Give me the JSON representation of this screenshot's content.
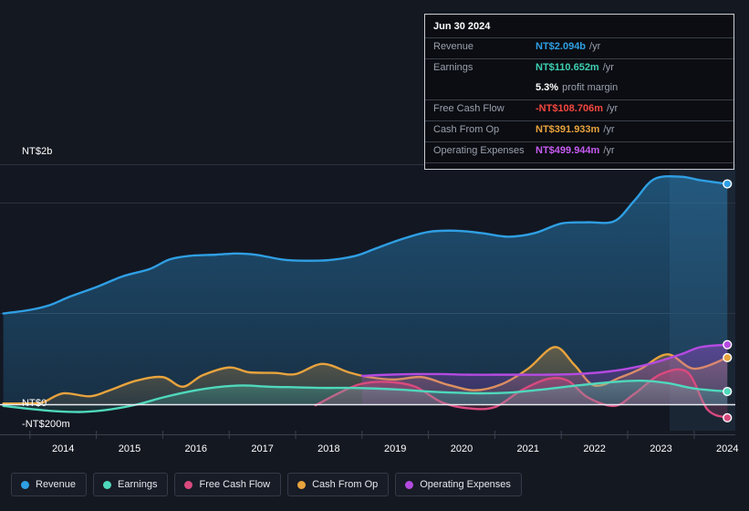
{
  "tooltip": {
    "date": "Jun 30 2024",
    "rows": [
      {
        "key": "Revenue",
        "value": "NT$2.094b",
        "suffix": "/yr",
        "color": "#2f9fe3"
      },
      {
        "key": "Earnings",
        "value": "NT$110.652m",
        "suffix": "/yr",
        "color": "#3ecfb2"
      },
      {
        "key": "",
        "value": "5.3%",
        "suffix": "profit margin",
        "color": "#ffffff"
      },
      {
        "key": "Free Cash Flow",
        "value": "-NT$108.706m",
        "suffix": "/yr",
        "color": "#f4473f"
      },
      {
        "key": "Cash From Op",
        "value": "NT$391.933m",
        "suffix": "/yr",
        "color": "#e8a33d"
      },
      {
        "key": "Operating Expenses",
        "value": "NT$499.944m",
        "suffix": "/yr",
        "color": "#c65cf0"
      }
    ]
  },
  "legend": [
    {
      "label": "Revenue",
      "color": "#2f9fe3"
    },
    {
      "label": "Earnings",
      "color": "#4fd8bc"
    },
    {
      "label": "Free Cash Flow",
      "color": "#d94a7e"
    },
    {
      "label": "Cash From Op",
      "color": "#e8a33d"
    },
    {
      "label": "Operating Expenses",
      "color": "#b44ae0"
    }
  ],
  "chart_data": {
    "type": "area",
    "title": "",
    "xlabel": "",
    "ylabel": "",
    "x_tick_labels": [
      "2014",
      "2015",
      "2016",
      "2017",
      "2018",
      "2019",
      "2020",
      "2021",
      "2022",
      "2023",
      "2024"
    ],
    "y_tick_labels": [
      "NT$2b",
      "NT$0",
      "-NT$200m"
    ],
    "ylim": [
      -200000000,
      2200000000
    ],
    "grid": true,
    "legend_position": "bottom",
    "currency": "NT$",
    "series": [
      {
        "name": "Revenue",
        "color": "#2f9fe3",
        "x": [
          2013.6,
          2014.0,
          2014.3,
          2014.6,
          2015.0,
          2015.4,
          2015.8,
          2016.1,
          2016.4,
          2016.8,
          2017.1,
          2017.4,
          2017.8,
          2018.1,
          2018.5,
          2018.9,
          2019.2,
          2019.6,
          2020.0,
          2020.4,
          2020.8,
          2021.2,
          2021.6,
          2022.0,
          2022.4,
          2022.8,
          2023.1,
          2023.4,
          2023.8,
          2024.1,
          2024.5
        ],
        "values": [
          760,
          790,
          830,
          900,
          980,
          1070,
          1130,
          1210,
          1240,
          1250,
          1260,
          1250,
          1210,
          1200,
          1205,
          1240,
          1300,
          1380,
          1440,
          1450,
          1430,
          1400,
          1430,
          1510,
          1520,
          1530,
          1700,
          1880,
          1900,
          1870,
          1840
        ],
        "unit": "NT$m"
      },
      {
        "name": "Earnings",
        "color": "#4fd8bc",
        "x": [
          2013.6,
          2014.0,
          2014.4,
          2014.8,
          2015.2,
          2015.6,
          2016.0,
          2016.4,
          2016.8,
          2017.2,
          2017.6,
          2018.0,
          2018.4,
          2018.8,
          2019.2,
          2019.6,
          2020.0,
          2020.4,
          2020.8,
          2021.2,
          2021.6,
          2022.0,
          2022.4,
          2022.8,
          2023.2,
          2023.6,
          2024.0,
          2024.5
        ],
        "values": [
          -10,
          -35,
          -55,
          -60,
          -40,
          0,
          60,
          110,
          145,
          160,
          150,
          145,
          140,
          140,
          135,
          125,
          110,
          100,
          95,
          100,
          120,
          145,
          170,
          190,
          200,
          180,
          135,
          110
        ],
        "unit": "NT$m"
      },
      {
        "name": "Free Cash Flow",
        "color": "#d94a7e",
        "x": [
          2018.3,
          2018.7,
          2019.0,
          2019.4,
          2019.8,
          2020.2,
          2020.6,
          2021.0,
          2021.4,
          2021.8,
          2022.1,
          2022.4,
          2022.8,
          2023.1,
          2023.5,
          2023.9,
          2024.2,
          2024.5
        ],
        "values": [
          -5,
          110,
          175,
          190,
          150,
          20,
          -30,
          -20,
          120,
          215,
          200,
          60,
          -10,
          90,
          255,
          270,
          -40,
          -109
        ],
        "unit": "NT$m"
      },
      {
        "name": "Cash From Op",
        "color": "#e8a33d",
        "x": [
          2013.6,
          2014.0,
          2014.2,
          2014.5,
          2014.9,
          2015.2,
          2015.6,
          2016.0,
          2016.3,
          2016.6,
          2017.0,
          2017.3,
          2017.7,
          2018.0,
          2018.4,
          2018.8,
          2019.1,
          2019.5,
          2019.9,
          2020.3,
          2020.7,
          2021.1,
          2021.5,
          2021.9,
          2022.2,
          2022.5,
          2022.9,
          2023.2,
          2023.6,
          2024.0,
          2024.5
        ],
        "values": [
          10,
          12,
          20,
          95,
          70,
          120,
          200,
          230,
          150,
          245,
          310,
          270,
          265,
          255,
          340,
          270,
          230,
          210,
          230,
          165,
          120,
          170,
          300,
          480,
          330,
          160,
          230,
          300,
          420,
          300,
          392
        ],
        "unit": "NT$m"
      },
      {
        "name": "Operating Expenses",
        "color": "#b44ae0",
        "x": [
          2019.0,
          2019.4,
          2019.8,
          2020.2,
          2020.6,
          2021.0,
          2021.4,
          2021.8,
          2022.2,
          2022.6,
          2023.0,
          2023.4,
          2023.8,
          2024.1,
          2024.5
        ],
        "values": [
          240,
          250,
          255,
          255,
          250,
          250,
          250,
          250,
          255,
          270,
          300,
          350,
          420,
          480,
          500
        ],
        "unit": "NT$m"
      }
    ]
  }
}
